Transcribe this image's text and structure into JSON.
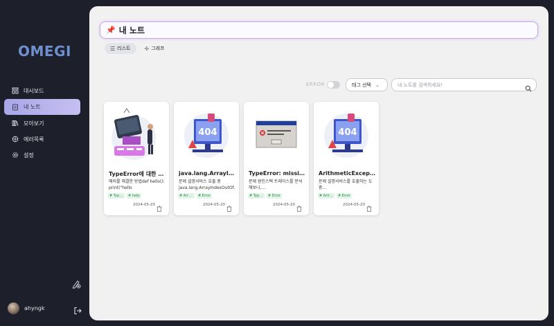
{
  "app": {
    "logo": "OMEGI"
  },
  "sidebar": {
    "items": [
      {
        "label": "대시보드",
        "icon": "dashboard-icon",
        "active": false
      },
      {
        "label": "내 노트",
        "icon": "note-icon",
        "active": true
      },
      {
        "label": "모아보기",
        "icon": "collection-icon",
        "active": false
      },
      {
        "label": "에러목록",
        "icon": "bug-icon",
        "active": false
      },
      {
        "label": "설정",
        "icon": "gear-icon",
        "active": false
      }
    ],
    "user": {
      "name": "ahyngk"
    }
  },
  "main": {
    "title_pin": "📌",
    "title": "내 노트",
    "view_tabs": [
      {
        "label": "리스트",
        "icon": "list-icon",
        "active": true
      },
      {
        "label": "그래프",
        "icon": "graph-icon",
        "active": false
      }
    ],
    "filter": {
      "error_label": "ERROR",
      "tag_select_label": "태그 선택",
      "search_placeholder": "내 노트를 검색하세요!"
    },
    "cards": [
      {
        "title": "TypeError에 대한 …",
        "desc": "에러를 해결한 방법def hello(): print(\"hello World!\")insert…",
        "tags": [
          "# TypeE..",
          "# help"
        ],
        "date": "2024-05-20",
        "image": "computer-error-illustration"
      },
      {
        "title": "java.lang.ArrayInd…",
        "desc": "문제 설명서비스 호출 중 java.lang.ArrayIndexOutOf…",
        "tags": [
          "# Array..",
          "# Error"
        ],
        "date": "2024-05-20",
        "image": "404-illustration"
      },
      {
        "title": "TypeError: missing…",
        "desc": "문제 원인스택 트레이스를 분석해보니,…",
        "tags": [
          "# TypeE..",
          "# Error"
        ],
        "date": "2024-05-20",
        "image": "error-dialog-screenshot"
      },
      {
        "title": "ArithmeticExceptio…",
        "desc": "문제 설명서비스를 호출하는 도중…",
        "tags": [
          "# Arith..",
          "# Error"
        ],
        "date": "2024-05-20",
        "image": "404-illustration"
      }
    ]
  },
  "colors": {
    "sidebar_bg": "#1d1f2b",
    "main_bg": "#f1f1f2",
    "active_nav": "#b6b1ee",
    "tag_green": "#2a8a4c",
    "title_border": "#c8a7e6"
  }
}
